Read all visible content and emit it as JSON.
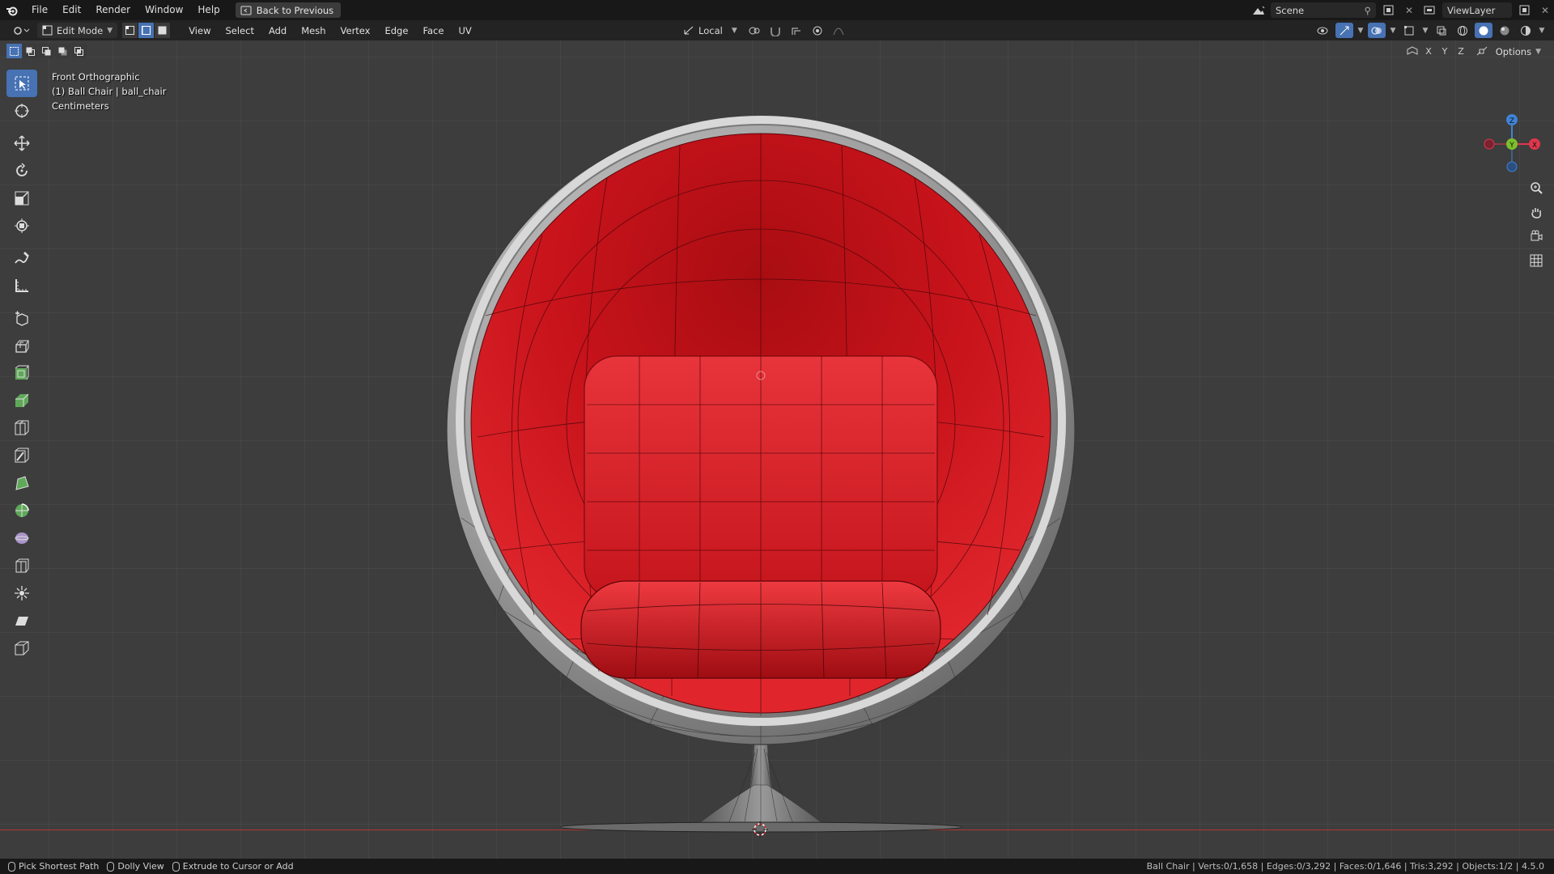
{
  "menubar": {
    "items": [
      "File",
      "Edit",
      "Render",
      "Window",
      "Help"
    ],
    "back_button": "Back to Previous",
    "scene": "Scene",
    "view_layer": "ViewLayer"
  },
  "header": {
    "mode": "Edit Mode",
    "menus": [
      "View",
      "Select",
      "Add",
      "Mesh",
      "Vertex",
      "Edge",
      "Face",
      "UV"
    ],
    "transform_orientation": "Local"
  },
  "tool_header": {
    "axis_locks": [
      "X",
      "Y",
      "Z"
    ],
    "options_label": "Options"
  },
  "viewport": {
    "view_name": "Front Orthographic",
    "object_info": "(1) Ball Chair | ball_chair",
    "units": "Centimeters",
    "gizmo_axes": {
      "z": "Z",
      "y": "Y",
      "x": "X"
    }
  },
  "colors": {
    "accent": "#4772b3",
    "chair_shell": "#8e8e8e",
    "chair_interior": "#d3131d",
    "axis_x": "#e0374c",
    "axis_y": "#7cbf2c",
    "axis_z": "#3f83d6"
  },
  "toolbar_icons": [
    "select-box-icon",
    "cursor-icon",
    "move-icon",
    "rotate-icon",
    "scale-icon",
    "transform-icon",
    "annotate-icon",
    "measure-icon",
    "add-cube-icon",
    "extrude-region-icon",
    "inset-faces-icon",
    "bevel-icon",
    "loop-cut-icon",
    "knife-icon",
    "poly-build-icon",
    "spin-icon",
    "smooth-icon",
    "edge-slide-icon",
    "shrink-fatten-icon",
    "shear-icon",
    "rip-region-icon"
  ],
  "statusbar": {
    "hints": [
      "Pick Shortest Path",
      "Dolly View",
      "Extrude to Cursor or Add"
    ],
    "stats": "Ball Chair | Verts:0/1,658 | Edges:0/3,292 | Faces:0/1,646 | Tris:3,292 | Objects:1/2 | 4.5.0"
  }
}
